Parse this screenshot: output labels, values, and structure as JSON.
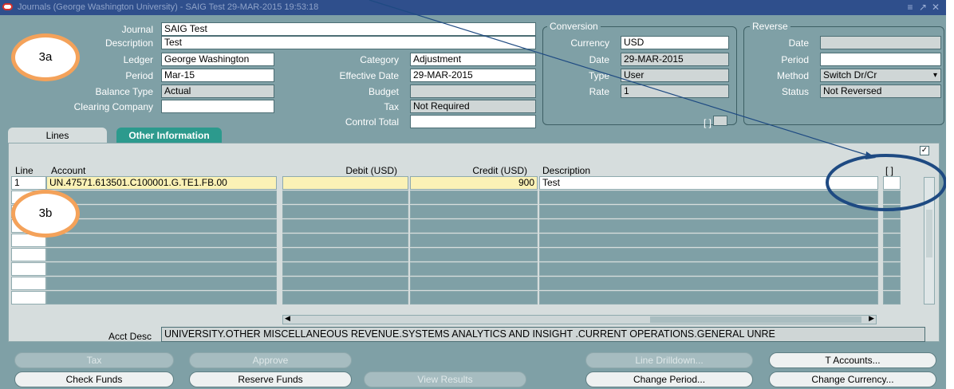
{
  "window": {
    "title": "Journals (George Washington University) - SAIG Test 29-MAR-2015 19:53:18",
    "controls": [
      "minimize",
      "restore",
      "close"
    ]
  },
  "header": {
    "journal_label": "Journal",
    "journal_value": "SAIG Test",
    "description_label": "Description",
    "description_value": "Test",
    "ledger_label": "Ledger",
    "ledger_value": "George Washington",
    "period_label": "Period",
    "period_value": "Mar-15",
    "balance_type_label": "Balance Type",
    "balance_type_value": "Actual",
    "clearing_company_label": "Clearing Company",
    "clearing_company_value": "",
    "category_label": "Category",
    "category_value": "Adjustment",
    "effective_date_label": "Effective Date",
    "effective_date_value": "29-MAR-2015",
    "budget_label": "Budget",
    "budget_value": "",
    "tax_label": "Tax",
    "tax_value": "Not Required",
    "control_total_label": "Control Total",
    "control_total_value": ""
  },
  "conversion": {
    "title": "Conversion",
    "currency_label": "Currency",
    "currency_value": "USD",
    "date_label": "Date",
    "date_value": "29-MAR-2015",
    "type_label": "Type",
    "type_value": "User",
    "rate_label": "Rate",
    "rate_value": "1",
    "bracket": "[ ]"
  },
  "reverse": {
    "title": "Reverse",
    "date_label": "Date",
    "date_value": "",
    "period_label": "Period",
    "period_value": "",
    "method_label": "Method",
    "method_value": "Switch Dr/Cr",
    "status_label": "Status",
    "status_value": "Not Reversed"
  },
  "tabs": [
    {
      "label": "Lines",
      "active": true
    },
    {
      "label": "Other Information",
      "active": false
    }
  ],
  "lines": {
    "columns": [
      "Line",
      "Account",
      "Debit (USD)",
      "Credit (USD)",
      "Description",
      "[ ]"
    ],
    "rows": [
      {
        "line": "1",
        "account": "UN.47571.613501.C100001.G.TE1.FB.00",
        "debit": "",
        "credit": "900",
        "description": "Test"
      }
    ],
    "acct_desc_label": "Acct Desc",
    "acct_desc_value": "UNIVERSITY.OTHER MISCELLANEOUS REVENUE.SYSTEMS ANALYTICS AND INSIGHT .CURRENT OPERATIONS.GENERAL UNRE"
  },
  "buttons": {
    "tax": "Tax",
    "approve": "Approve",
    "line_drilldown": "Line Drilldown...",
    "t_accounts": "T Accounts...",
    "check_funds": "Check Funds",
    "reserve_funds": "Reserve Funds",
    "view_results": "View Results",
    "change_period": "Change Period...",
    "change_currency": "Change Currency..."
  },
  "annotations": {
    "callout_a": "3a",
    "callout_b": "3b"
  },
  "colors": {
    "background": "#7fa0a6",
    "titlebar": "#2f4f8c",
    "tab_active": "#d6dddd",
    "tab_inactive": "#2c9a8d",
    "required_field": "#fbf2b6",
    "callout_orange": "#f4a25a",
    "circle_blue": "#1e4a82"
  }
}
